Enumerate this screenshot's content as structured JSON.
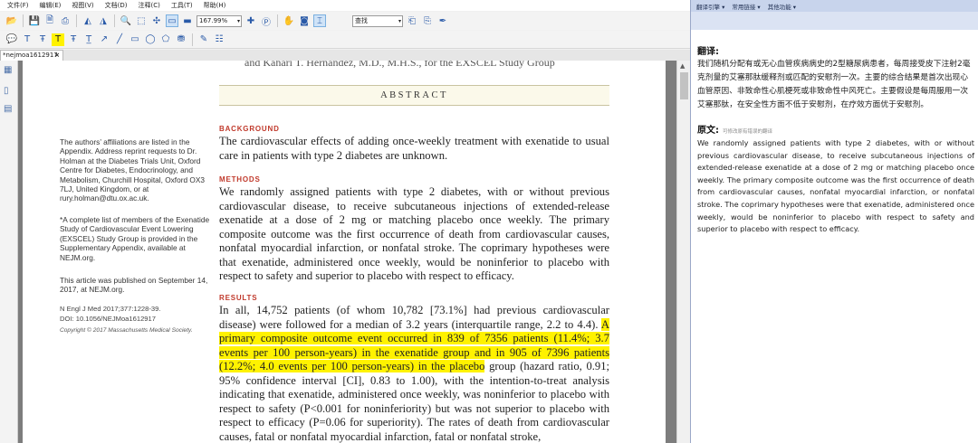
{
  "menubar": [
    "文件(F)",
    "编辑(E)",
    "视图(V)",
    "文档(D)",
    "注释(C)",
    "工具(T)",
    "帮助(H)"
  ],
  "toolbar": {
    "zoom": "167.99%",
    "search_placeholder": "查找"
  },
  "tab": {
    "title": "*nejmoa1612917",
    "close": "×"
  },
  "page": {
    "top_cut": "and Kahari T. Hernandez, M.D., M.H.S., for the EXSCEL Study Group",
    "abstract_title": "ABSTRACT",
    "sections": {
      "background_head": "BACKGROUND",
      "background_text": "The cardiovascular effects of adding once-weekly treatment with exenatide to usual care in patients with type 2 diabetes are unknown.",
      "methods_head": "METHODS",
      "methods_text": "We randomly assigned patients with type 2 diabetes, with or without previous cardiovascular disease, to receive subcutaneous injections of extended-release exenatide at a dose of 2 mg or matching placebo once weekly. The primary composite outcome was the first occurrence of death from cardiovascular causes, nonfatal myocardial infarction, or nonfatal stroke. The coprimary hypotheses were that exenatide, administered once weekly, would be noninferior to placebo with respect to safety and superior to placebo with respect to efficacy.",
      "results_head": "RESULTS",
      "results_text_1": "In all, 14,752 patients (of whom 10,782 [73.1%] had previous cardiovascular disease) were followed for a median of 3.2 years (interquartile range, 2.2 to 4.4). ",
      "results_highlight": "A primary composite outcome event occurred in 839 of 7356 patients (11.4%; 3.7 events per 100 person-years) in the exenatide group and in 905 of 7396 patients (12.2%; 4.0 events per 100 person-years) in the placebo",
      "results_text_2": " group (hazard ratio, 0.91; 95% confidence interval [CI], 0.83 to 1.00), with the intention-to-treat analysis indicating that exenatide, administered once weekly, was noninferior to placebo with respect to safety (P<0.001 for noninferiority) but was not superior to placebo with respect to efficacy (P=0.06 for superiority). The rates of death from cardiovascular causes, fatal or nonfatal myocardial infarction, fatal or nonfatal stroke,"
    },
    "sidenotes": {
      "affiliations": "The authors’ affiliations are listed in the Appendix. Address reprint requests to Dr. Holman at the Diabetes Trials Unit, Oxford Centre for Diabetes, Endocrinology, and Metabolism, Churchill Hospital, Oxford OX3 7LJ, United Kingdom, or at rury.holman@dtu.ox.ac.uk.",
      "members": "*A complete list of members of the Exenatide Study of Cardiovascular Event Lowering (EXSCEL) Study Group is provided in the Supplementary Appendix, available at NEJM.org.",
      "published": "This article was published on September 14, 2017, at NEJM.org.",
      "citation": "N Engl J Med 2017;377:1228-39.",
      "doi": "DOI: 10.1056/NEJMoa1612917",
      "copyright": "Copyright © 2017 Massachusetts Medical Society."
    }
  },
  "translation": {
    "toolbar": [
      "翻译引擎 ▾",
      "常用链接 ▾",
      "其他功能 ▾"
    ],
    "zh_head": "翻译:",
    "zh_text": "我们随机分配有或无心血管疾病病史的2型糖尿病患者，每周接受皮下注射2毫克剂量的艾塞那肽缓释剂或匹配的安慰剂一次。主要的综合结果是首次出现心血管原因、非致命性心肌梗死或非致命性中风死亡。主要假设是每周服用一次艾塞那肽，在安全性方面不低于安慰剂，在疗效方面优于安慰剂。",
    "en_head": "原文:",
    "en_sub": "可修改原有错误的翻译",
    "en_text": "We randomly assigned patients with type 2 diabetes, with or without previous cardiovascular disease, to receive subcutaneous injections of extended-release exenatide at a dose of 2 mg or matching placebo once weekly. The primary composite outcome was the first occurrence of death from cardiovascular causes, nonfatal myocardial infarction, or nonfatal stroke. The coprimary hypotheses were that exenatide, administered once weekly, would be noninferior to placebo with respect to safety and superior to placebo with respect to efficacy."
  },
  "colors": {
    "highlight": "#fff200",
    "section_head": "#c0392b",
    "abstract_bar": "#fbf9ea",
    "trans_toolbar": "#c8d4ec"
  },
  "icons": [
    "open-icon",
    "save-icon",
    "print-icon",
    "zoom-icon",
    "hand-icon",
    "select-icon",
    "comment-icon"
  ]
}
